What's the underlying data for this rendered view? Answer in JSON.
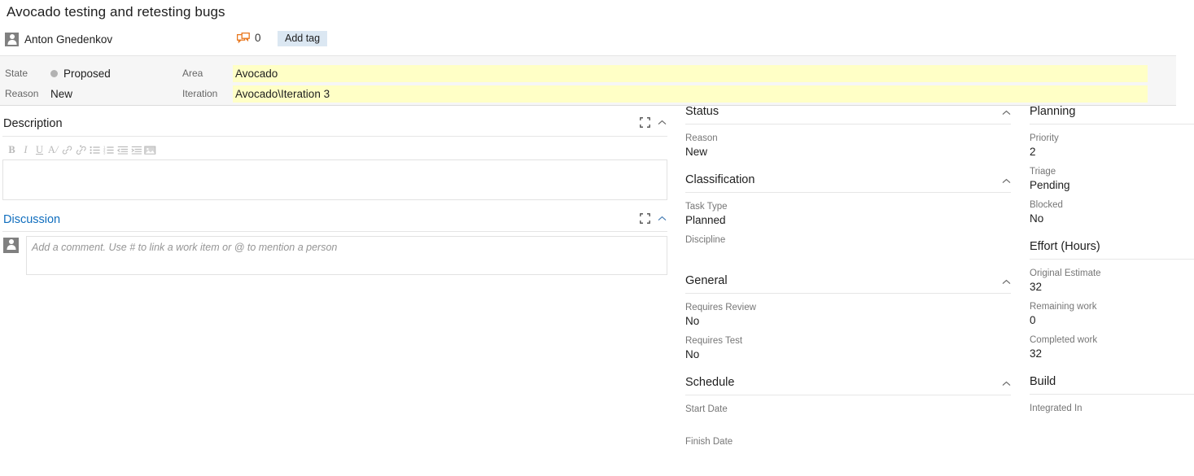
{
  "header": {
    "title": "Avocado testing and retesting bugs",
    "assigned_to": "Anton Gnedenkov",
    "avatar_icon": "person-avatar-icon",
    "comment_icon": "comment-bubbles-icon",
    "comment_count": "0",
    "add_tag_label": "Add tag"
  },
  "fields": {
    "state_label": "State",
    "state_value": "Proposed",
    "reason_label": "Reason",
    "reason_value": "New",
    "area_label": "Area",
    "area_value": "Avocado",
    "iteration_label": "Iteration",
    "iteration_value": "Avocado\\Iteration 3"
  },
  "description": {
    "title": "Description",
    "expand_icon": "expand-icon",
    "collapse_icon": "chevron-up-icon",
    "body": "",
    "toolbar": [
      {
        "name": "bold-icon",
        "glyph": "B"
      },
      {
        "name": "italic-icon",
        "glyph": "I"
      },
      {
        "name": "underline-icon",
        "glyph": "U"
      },
      {
        "name": "clear-formatting-icon",
        "glyph": "A"
      },
      {
        "name": "link-icon",
        "glyph": "🔗"
      },
      {
        "name": "unlink-icon",
        "glyph": "🔗"
      },
      {
        "name": "bullet-list-icon",
        "glyph": "☰"
      },
      {
        "name": "numbered-list-icon",
        "glyph": "≣"
      },
      {
        "name": "outdent-icon",
        "glyph": "←"
      },
      {
        "name": "indent-icon",
        "glyph": "→"
      },
      {
        "name": "insert-image-icon",
        "glyph": "▣"
      }
    ]
  },
  "discussion": {
    "title": "Discussion",
    "expand_icon": "expand-icon",
    "collapse_icon": "chevron-up-icon",
    "avatar_icon": "person-avatar-icon",
    "comment_placeholder": "Add a comment. Use # to link a work item or @ to mention a person"
  },
  "middle_column": [
    {
      "title": "Status",
      "collapsible": true,
      "fields": [
        {
          "label": "Reason",
          "value": "New"
        }
      ]
    },
    {
      "title": "Classification",
      "collapsible": true,
      "fields": [
        {
          "label": "Task Type",
          "value": "Planned"
        },
        {
          "label": "Discipline",
          "value": ""
        }
      ]
    },
    {
      "title": "General",
      "collapsible": true,
      "fields": [
        {
          "label": "Requires Review",
          "value": "No"
        },
        {
          "label": "Requires Test",
          "value": "No"
        }
      ]
    },
    {
      "title": "Schedule",
      "collapsible": true,
      "fields": [
        {
          "label": "Start Date",
          "value": ""
        },
        {
          "label": "Finish Date",
          "value": ""
        }
      ]
    }
  ],
  "right_column": [
    {
      "title": "Planning",
      "collapsible": false,
      "fields": [
        {
          "label": "Priority",
          "value": "2"
        },
        {
          "label": "Triage",
          "value": "Pending"
        },
        {
          "label": "Blocked",
          "value": "No"
        }
      ]
    },
    {
      "title": "Effort (Hours)",
      "collapsible": false,
      "fields": [
        {
          "label": "Original Estimate",
          "value": "32"
        },
        {
          "label": "Remaining work",
          "value": "0"
        },
        {
          "label": "Completed work",
          "value": "32"
        }
      ]
    },
    {
      "title": "Build",
      "collapsible": false,
      "fields": [
        {
          "label": "Integrated In",
          "value": ""
        }
      ]
    }
  ],
  "colors": {
    "accent_link": "#106ebe",
    "field_highlight": "#ffffc6",
    "band_background": "#f6f6f6",
    "tag_button": "#dbe7f2",
    "comment_icon": "#e8761c",
    "avatar": "#808080",
    "state_dot": "#b3b3b3"
  }
}
